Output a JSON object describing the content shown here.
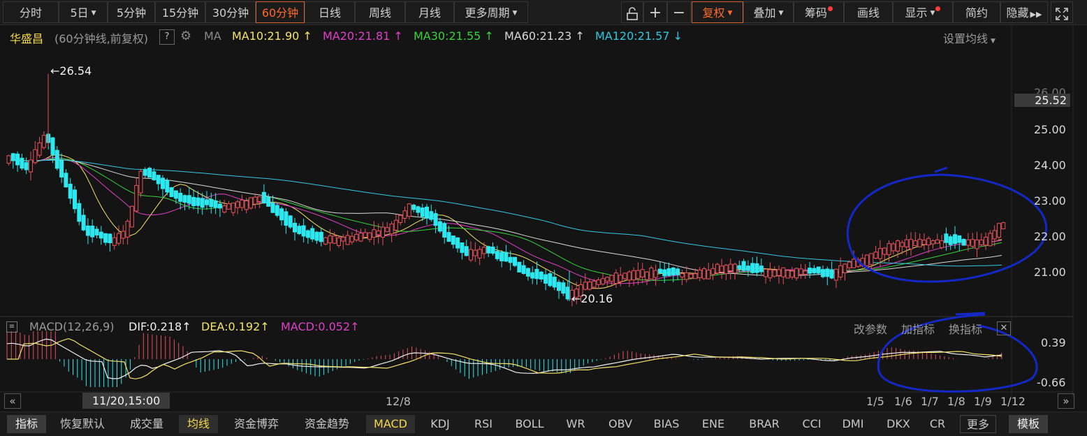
{
  "toolbar": {
    "periods": [
      "分时",
      "5日",
      "5分钟",
      "15分钟",
      "30分钟",
      "60分钟",
      "日线",
      "周线",
      "月线",
      "更多周期"
    ],
    "active_period": "60分钟",
    "tools": [
      "复权",
      "叠加",
      "筹码",
      "画线",
      "显示",
      "简约",
      "隐藏"
    ],
    "active_tool": "复权",
    "icons": [
      "unlock-icon",
      "plus-icon",
      "minus-icon",
      "fullscreen-icon"
    ]
  },
  "main_chart": {
    "stock_name": "华盛昌",
    "mode": "(60分钟线,前复权)",
    "help": "?",
    "ma_label": "MA",
    "ma_items": [
      {
        "text": "MA10:21.90",
        "arrow": "↑",
        "color": "#f4e36a"
      },
      {
        "text": "MA20:21.81",
        "arrow": "↑",
        "color": "#e040c8"
      },
      {
        "text": "MA30:21.55",
        "arrow": "↑",
        "color": "#39d23c"
      },
      {
        "text": "MA60:21.23",
        "arrow": "↑",
        "color": "#d8d8d8"
      },
      {
        "text": "MA120:21.57",
        "arrow": "↓",
        "color": "#35c6e2"
      }
    ],
    "settings_label": "设置均线",
    "price_axis": [
      "26.00",
      "25.00",
      "24.00",
      "23.00",
      "22.00",
      "21.00"
    ],
    "current_price": "25.52",
    "high_label": "26.54",
    "low_label": "20.16",
    "colors": {
      "up": "#e8505b",
      "down": "#2ee8f0",
      "bg": "#141414",
      "annotation": "#1428c8"
    }
  },
  "macd": {
    "name": "MACD(12,26,9)",
    "dif": "DIF:0.218",
    "dea": "DEA:0.192",
    "macd": "MACD:0.052",
    "arrow": "↑",
    "actions": [
      "改参数",
      "加指标",
      "换指标"
    ],
    "axis": [
      "0.39",
      "-0.66"
    ]
  },
  "time_axis": {
    "cursor": "11/20,15:00",
    "labels": [
      "12/8",
      "1/5",
      "1/6",
      "1/7",
      "1/8",
      "1/9",
      "1/12"
    ]
  },
  "bottom_tabs": [
    "指标",
    "恢复默认",
    "成交量",
    "均线",
    "资金博弈",
    "资金趋势",
    "MACD",
    "KDJ",
    "RSI",
    "BOLL",
    "WR",
    "OBV",
    "BIAS",
    "ENE",
    "BRAR",
    "CCI",
    "DMI",
    "DKX",
    "CR",
    "更多",
    "模板"
  ]
}
